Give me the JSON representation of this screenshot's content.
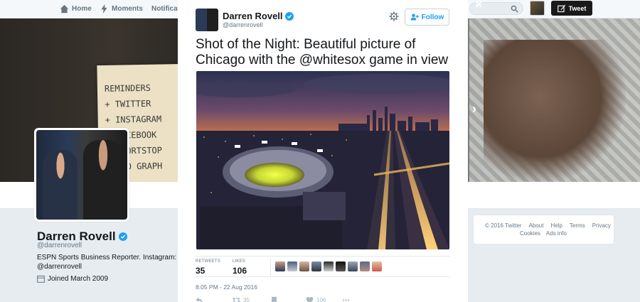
{
  "nav": {
    "home_label": "Home",
    "moments_label": "Moments",
    "notifications_label": "Notifications",
    "tweet_button_label": "Tweet"
  },
  "banner": {
    "note_lines": [
      "REMINDERS",
      "+ TWITTER",
      "+ INSTAGRAM",
      "+ FACEBOOK",
      "+ SHORTSTOP",
      "  TWO GRAPH"
    ]
  },
  "profile": {
    "name": "Darren Rovell",
    "handle": "@darrenrovell",
    "bio": "ESPN Sports Business Reporter. Instagram: @darrenrovell",
    "joined": "Joined March 2009"
  },
  "footer": {
    "copyright": "© 2016 Twitter",
    "links_row1": [
      "About",
      "Help",
      "Terms",
      "Privacy"
    ],
    "links_row2": [
      "Cookies",
      "Ads info"
    ]
  },
  "tweet": {
    "author_name": "Darren Rovell",
    "author_handle": "@darrenrovell",
    "follow_label": "Follow",
    "text": "Shot of the Night: Beautiful picture of Chicago with the @whitesox game in view",
    "retweets_label": "RETWEETS",
    "retweets_count": "35",
    "likes_label": "LIKES",
    "likes_count": "106",
    "timestamp": "8:05 PM - 22 Aug 2016",
    "action_retweet_count": "35",
    "action_like_count": "106"
  },
  "colors": {
    "accent": "#1da1f2",
    "verified": "#1da1f2"
  },
  "icons": {
    "home": "home-icon",
    "moments": "lightning-icon",
    "notifications": "bell-icon",
    "search": "search-icon",
    "compose": "quill-icon",
    "close": "close-icon",
    "settings": "gear-icon",
    "follow": "add-user-icon",
    "calendar": "calendar-icon",
    "chevron": "chevron-right-icon"
  }
}
